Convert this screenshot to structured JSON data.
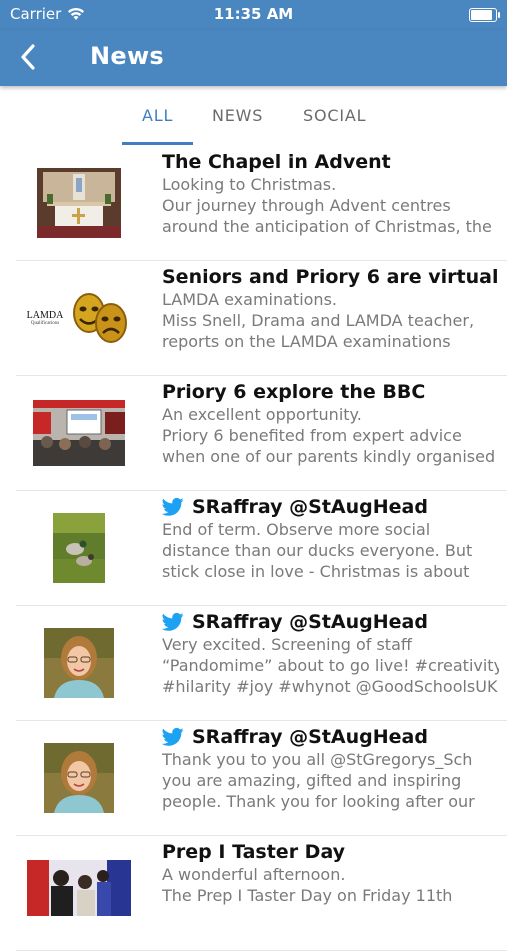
{
  "status_bar": {
    "carrier": "Carrier",
    "time": "11:35 AM",
    "battery_level": 0.95
  },
  "nav": {
    "title": "News"
  },
  "tabs": [
    {
      "label": "ALL",
      "active": true
    },
    {
      "label": "NEWS",
      "active": false
    },
    {
      "label": "SOCIAL",
      "active": false
    }
  ],
  "feed": [
    {
      "title": "The Chapel in Advent",
      "twitter": false,
      "thumb": "chapel-photo",
      "lines": [
        "Looking to Christmas.",
        "Our journey through Advent centres",
        "around the anticipation of Christmas, the"
      ]
    },
    {
      "title": "Seniors and Priory 6 are virtually",
      "twitter": false,
      "thumb": "lamda-logo",
      "logo_text": "LAMDA",
      "logo_subtext": "Qualifications",
      "lines": [
        "LAMDA examinations.",
        "Miss Snell, Drama and LAMDA teacher,",
        "reports on the LAMDA examinations"
      ]
    },
    {
      "title": "Priory 6 explore the BBC",
      "twitter": false,
      "thumb": "classroom-photo",
      "lines": [
        "An excellent opportunity.",
        "Priory 6 benefited from expert advice",
        "when one of our parents kindly organised"
      ]
    },
    {
      "title": "SRaffray @StAugHead",
      "twitter": true,
      "thumb": "ducks-photo",
      "lines": [
        "End of term. Observe more social",
        "distance than our ducks everyone. But",
        "stick close in love - Christmas is about"
      ]
    },
    {
      "title": "SRaffray @StAugHead",
      "twitter": true,
      "thumb": "portrait-photo",
      "lines": [
        "Very excited. Screening of staff",
        "“Pandomime” about to go live! #creativity",
        "#hilarity #joy #whynot @GoodSchoolsUK"
      ]
    },
    {
      "title": "SRaffray @StAugHead",
      "twitter": true,
      "thumb": "portrait-photo",
      "lines": [
        "Thank you to you all @StGregorys_Sch",
        "you are amazing, gifted and inspiring",
        "people. Thank you for looking after our"
      ]
    },
    {
      "title": "Prep I Taster Day",
      "twitter": false,
      "thumb": "taster-photo",
      "lines": [
        "A wonderful afternoon.",
        "The Prep I Taster Day on Friday 11th",
        ""
      ]
    }
  ],
  "colors": {
    "nav_bg": "#4a86bf",
    "accent": "#3f7fbf",
    "twitter": "#1da1f2"
  }
}
